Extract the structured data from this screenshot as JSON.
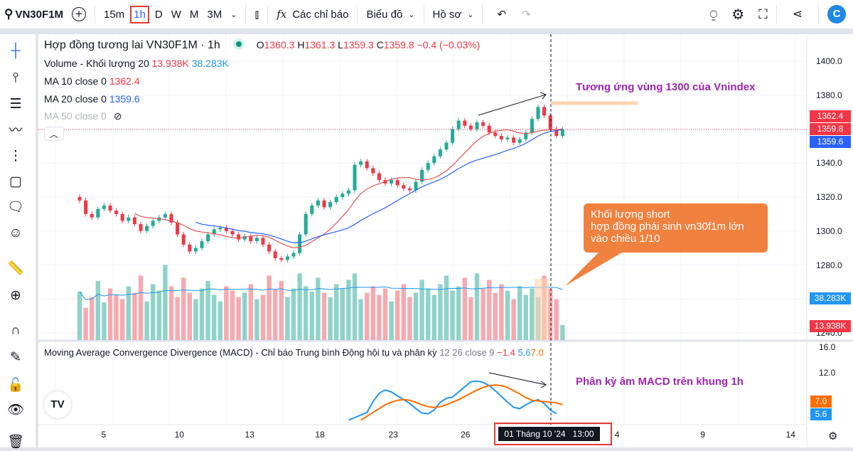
{
  "toolbar": {
    "symbol": "VN30F1M",
    "intervals": [
      "15m",
      "1h",
      "D",
      "W",
      "M",
      "3M"
    ],
    "selected_interval": "1h",
    "indicators": "Các chỉ báo",
    "chart": "Biểu đồ",
    "profile": "Hồ sơ"
  },
  "legend": {
    "title": "Hợp đồng tương lai VN30F1M · 1h",
    "o_label": "O",
    "o": "1360.3",
    "h_label": "H",
    "h": "1361.3",
    "l_label": "L",
    "l": "1359.3",
    "c_label": "C",
    "c": "1359.8",
    "change": "−0.4 (−0.03%)",
    "volume": "Volume - Khối lượng 20",
    "vol1": "13.938K",
    "vol2": "38.283K",
    "ma10": "MA 10 close 0",
    "ma10_val": "1362.4",
    "ma20": "MA 20 close 0",
    "ma20_val": "1359.6",
    "ma50": "MA 50 close 0",
    "macd": "Moving Average Convergence Divergence (MACD) - Chỉ báo Trung bình Động hội tụ và phân kỳ",
    "macd_params": "12 26 close 9",
    "macd_hist": "−1.4",
    "macd_val": "5.6",
    "macd_signal": "7.0"
  },
  "price_labels": {
    "ma10": "1362.4",
    "close": "1359.8",
    "ma20": "1359.6",
    "vol_ma": "38.283K",
    "vol": "13.938K",
    "macd_signal": "7.0",
    "macd": "5.6"
  },
  "annotations": {
    "top": "Tương ứng vùng 1300 của Vnindex",
    "box": [
      "Khối lượng short",
      "hợp đồng phái sinh vn30f1m lớn",
      "vào chiều 1/10"
    ],
    "macd": "Phân kỳ âm MACD trên khung 1h"
  },
  "crosshair_label": "01 Tháng 10 '24   13:00",
  "colors": {
    "up": "#22ab94",
    "down": "#f23645",
    "ma10": "#e0575b",
    "ma20": "#2962ff",
    "macd": "#2196f3",
    "signal": "#ff6d00",
    "annotation": "#9c27b0",
    "box": "#f0813f"
  },
  "chart_data": {
    "type": "candlestick",
    "price_axis": {
      "ticks": [
        "1400.0",
        "1380.0",
        "1360.0",
        "1340.0",
        "1320.0",
        "1300.0",
        "1280.0",
        "1260.0",
        "1240.0"
      ],
      "range": [
        1240,
        1400
      ]
    },
    "macd_axis": {
      "ticks": [
        "16.0",
        "12.0"
      ],
      "range": [
        3,
        16
      ]
    },
    "time_ticks": [
      {
        "label": "5",
        "i": 4
      },
      {
        "label": "10",
        "i": 16
      },
      {
        "label": "13",
        "i": 27.5
      },
      {
        "label": "18",
        "i": 39
      },
      {
        "label": "23",
        "i": 51
      },
      {
        "label": "26",
        "i": 62.8
      },
      {
        "label": "4",
        "i": 88
      },
      {
        "label": "9",
        "i": 102
      },
      {
        "label": "14",
        "i": 116
      }
    ],
    "closes": [
      1318,
      1310,
      1308,
      1313,
      1315,
      1312,
      1310,
      1306,
      1308,
      1304,
      1300,
      1303,
      1306,
      1308,
      1310,
      1305,
      1298,
      1292,
      1288,
      1290,
      1294,
      1298,
      1301,
      1302,
      1300,
      1298,
      1295,
      1297,
      1294,
      1296,
      1292,
      1288,
      1284,
      1283,
      1285,
      1287,
      1298,
      1310,
      1315,
      1318,
      1314,
      1317,
      1320,
      1322,
      1324,
      1339,
      1341,
      1337,
      1334,
      1330,
      1328,
      1330,
      1327,
      1325,
      1324,
      1329,
      1336,
      1340,
      1344,
      1348,
      1352,
      1360,
      1365,
      1362,
      1360,
      1364,
      1362,
      1358,
      1356,
      1354,
      1355,
      1352,
      1354,
      1358,
      1366,
      1373,
      1368,
      1360,
      1356,
      1359.8
    ],
    "volumes_k": [
      45,
      30,
      40,
      55,
      35,
      48,
      42,
      38,
      50,
      44,
      60,
      36,
      52,
      46,
      70,
      50,
      40,
      58,
      44,
      38,
      48,
      55,
      42,
      36,
      50,
      46,
      40,
      44,
      52,
      38,
      42,
      60,
      47,
      55,
      40,
      48,
      62,
      50,
      45,
      58,
      44,
      40,
      52,
      48,
      56,
      62,
      38,
      44,
      50,
      42,
      48,
      36,
      46,
      52,
      40,
      44,
      56,
      48,
      42,
      52,
      60,
      46,
      50,
      58,
      40,
      62,
      48,
      56,
      44,
      52,
      46,
      38,
      50,
      42,
      48,
      40,
      60,
      48,
      38,
      14
    ],
    "macd": {
      "start": 44,
      "values": [
        4.6,
        5.0,
        5.4,
        5.8,
        7.5,
        8.8,
        9.3,
        9.0,
        8.4,
        7.8,
        7.2,
        6.4,
        5.7,
        5.6,
        6.2,
        7.4,
        8.0,
        8.2,
        9.0,
        9.8,
        10.6,
        10.7,
        10.5,
        10.0,
        9.2,
        8.3,
        7.4,
        6.6,
        6.4,
        7.0,
        7.5,
        7.8,
        7.2,
        6.2,
        5.6
      ]
    },
    "signal": {
      "start": 46,
      "values": [
        4.6,
        5.2,
        5.8,
        6.4,
        7.0,
        7.4,
        7.7,
        7.8,
        7.7,
        7.4,
        7.0,
        6.7,
        6.6,
        6.7,
        7.0,
        7.4,
        7.8,
        8.3,
        8.8,
        9.3,
        9.7,
        10.0,
        10.1,
        10.0,
        9.7,
        9.2,
        8.7,
        8.1,
        7.7,
        7.6,
        7.5,
        7.4,
        7.3,
        7.0
      ]
    }
  }
}
